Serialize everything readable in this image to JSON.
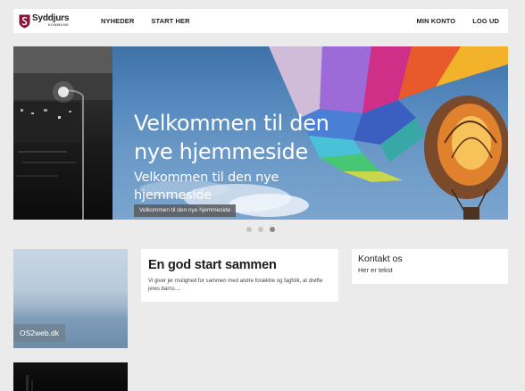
{
  "header": {
    "logo_name": "Syddjurs",
    "logo_sub": "KOMMUNE",
    "nav": {
      "news": "NYHEDER",
      "start": "START HER",
      "account": "MIN KONTO",
      "logout": "LOG UD"
    }
  },
  "hero": {
    "title_line1": "Velkommen til den",
    "title_line2": "nye hjemmeside",
    "subtitle_line1": "Velkommen til den nye",
    "subtitle_line2": "hjemmeside",
    "button_label": "Velkommen til den nye hjemmeside",
    "slides": 3,
    "active_slide": 3
  },
  "cards": {
    "image_card_caption": "OS2web.dk",
    "intro_title": "En god start sammen",
    "intro_text": "Vi giver jer mulighed for sammen med andre forældre og fagfolk, at drøfte jeres barns....",
    "contact_title": "Kontakt os",
    "contact_text": "Her er tekst"
  },
  "colors": {
    "page_bg": "#ebebeb",
    "logo_shield": "#8b1538"
  }
}
